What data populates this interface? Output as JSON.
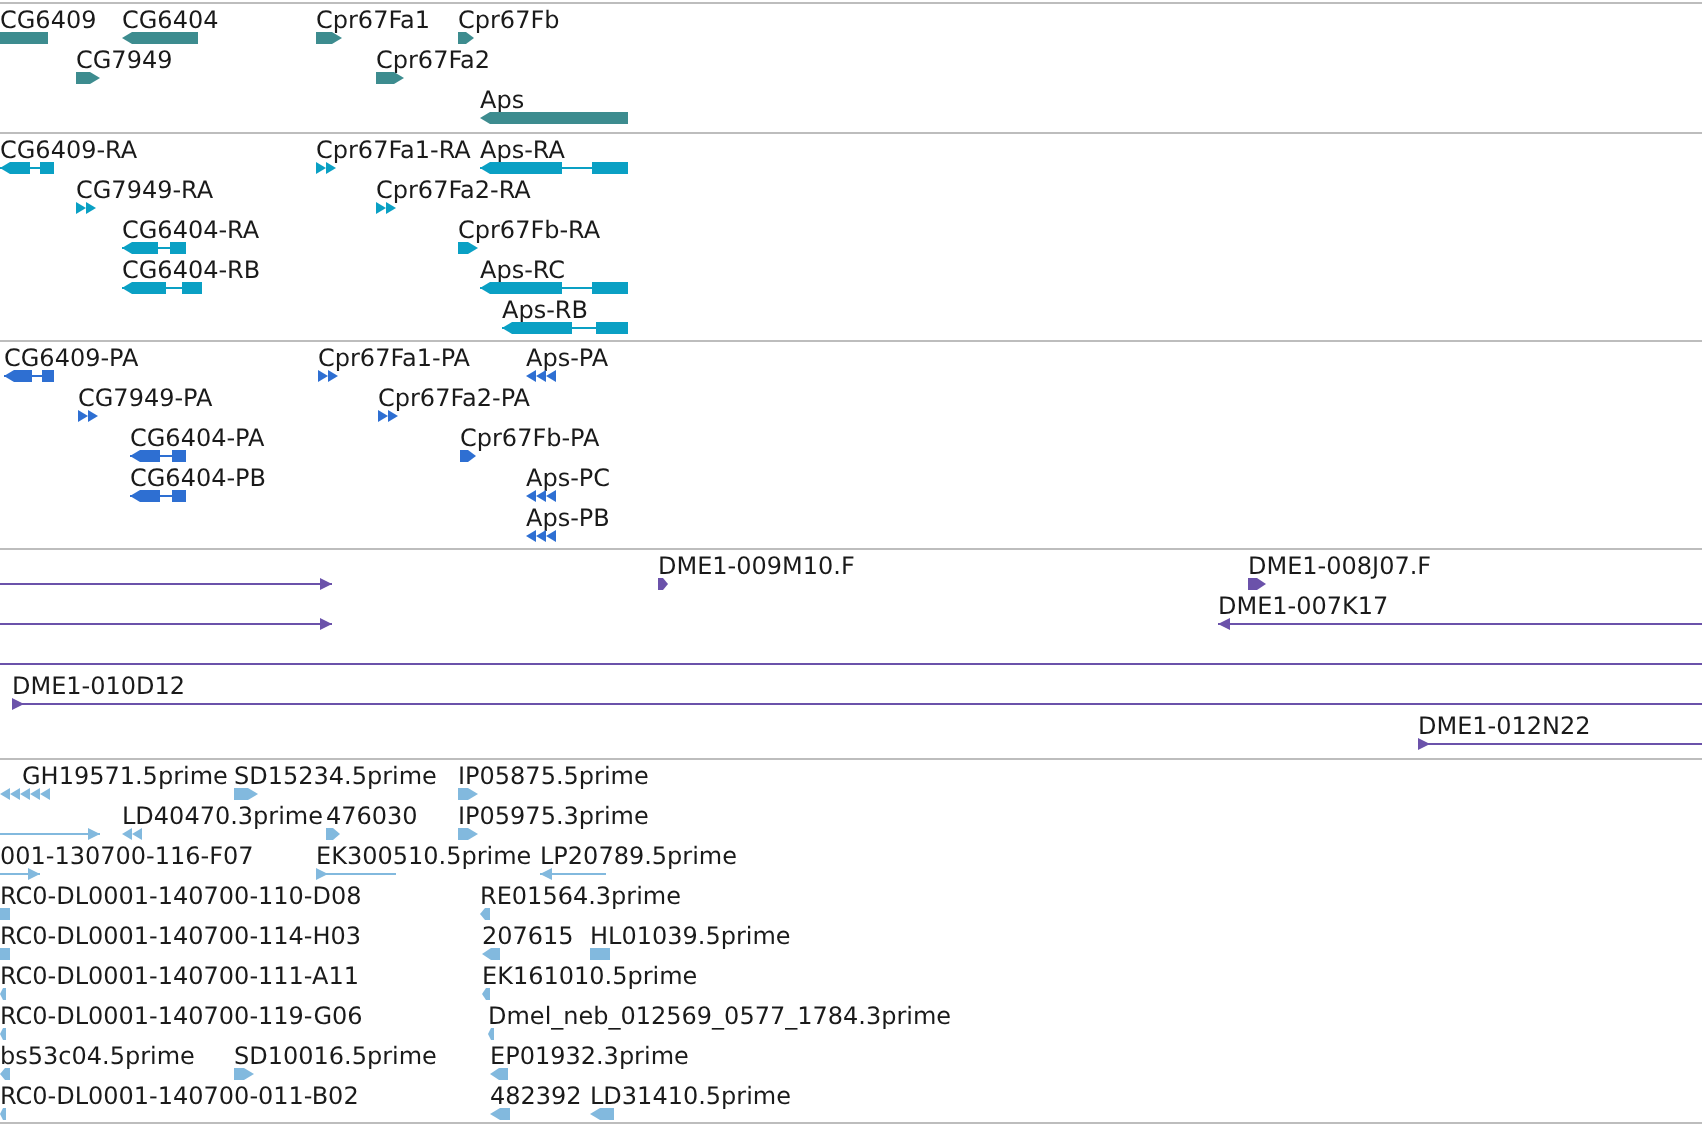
{
  "tracks": [
    {
      "kind": "gene",
      "features": [
        {
          "label": "CG6409",
          "kind": "block"
        },
        {
          "label": "CG6404",
          "kind": "block"
        },
        {
          "label": "Cpr67Fa1",
          "kind": "block"
        },
        {
          "label": "Cpr67Fb",
          "kind": "block"
        },
        {
          "label": "CG7949",
          "kind": "block"
        },
        {
          "label": "Cpr67Fa2",
          "kind": "block"
        },
        {
          "label": "Aps",
          "kind": "block"
        }
      ]
    },
    {
      "kind": "transcript",
      "features": [
        {
          "label": "CG6409-RA",
          "kind": "exons"
        },
        {
          "label": "Cpr67Fa1-RA",
          "kind": "chevrons"
        },
        {
          "label": "Aps-RA",
          "kind": "exons"
        },
        {
          "label": "CG7949-RA",
          "kind": "chevrons"
        },
        {
          "label": "Cpr67Fa2-RA",
          "kind": "chevrons"
        },
        {
          "label": "CG6404-RA",
          "kind": "exons"
        },
        {
          "label": "Cpr67Fb-RA",
          "kind": "block"
        },
        {
          "label": "CG6404-RB",
          "kind": "exons"
        },
        {
          "label": "Aps-RC",
          "kind": "exons"
        },
        {
          "label": "Aps-RB",
          "kind": "exons"
        }
      ]
    },
    {
      "kind": "protein",
      "features": [
        {
          "label": "CG6409-PA",
          "kind": "exons"
        },
        {
          "label": "Cpr67Fa1-PA",
          "kind": "chevrons"
        },
        {
          "label": "Aps-PA",
          "kind": "chevrons"
        },
        {
          "label": "CG7949-PA",
          "kind": "chevrons"
        },
        {
          "label": "Cpr67Fa2-PA",
          "kind": "chevrons"
        },
        {
          "label": "CG6404-PA",
          "kind": "exons"
        },
        {
          "label": "Cpr67Fb-PA",
          "kind": "block"
        },
        {
          "label": "CG6404-PB",
          "kind": "exons"
        },
        {
          "label": "Aps-PC",
          "kind": "chevrons"
        },
        {
          "label": "Aps-PB",
          "kind": "chevrons"
        }
      ]
    },
    {
      "kind": "clone",
      "features": [
        {
          "kind": "line_end"
        },
        {
          "label": "DME1-009M10.F",
          "kind": "block"
        },
        {
          "label": "DME1-008J07.F",
          "kind": "block"
        },
        {
          "kind": "line_end"
        },
        {
          "label": "DME1-007K17",
          "kind": "line"
        },
        {
          "kind": "line"
        },
        {
          "label": "DME1-010D12",
          "kind": "line"
        },
        {
          "label": "DME1-012N22",
          "kind": "line"
        }
      ]
    },
    {
      "kind": "est",
      "features": [
        {
          "label": "GH19571.5prime",
          "kind": "chevrons"
        },
        {
          "label": "SD15234.5prime",
          "kind": "block"
        },
        {
          "label": "IP05875.5prime",
          "kind": "block"
        },
        {
          "kind": "line_end"
        },
        {
          "label": "LD40470.3prime",
          "kind": "chevrons"
        },
        {
          "label": "476030",
          "kind": "block"
        },
        {
          "label": "IP05975.3prime",
          "kind": "block"
        },
        {
          "label": "001-130700-116-F07",
          "kind": "line_end"
        },
        {
          "label": "EK300510.5prime",
          "kind": "line"
        },
        {
          "label": "LP20789.5prime",
          "kind": "line"
        },
        {
          "label": "RC0-DL0001-140700-110-D08",
          "kind": "block"
        },
        {
          "label": "RE01564.3prime",
          "kind": "block"
        },
        {
          "label": "RC0-DL0001-140700-114-H03",
          "kind": "block"
        },
        {
          "label": "207615",
          "kind": "block"
        },
        {
          "label": "HL01039.5prime",
          "kind": "block"
        },
        {
          "label": "RC0-DL0001-140700-111-A11",
          "kind": "block"
        },
        {
          "label": "EK161010.5prime",
          "kind": "block"
        },
        {
          "label": "RC0-DL0001-140700-119-G06",
          "kind": "block"
        },
        {
          "label": "Dmel_neb_012569_0577_1784.3prime",
          "kind": "block"
        },
        {
          "label": "bs53c04.5prime",
          "kind": "block"
        },
        {
          "label": "SD10016.5prime",
          "kind": "block"
        },
        {
          "label": "EP01932.3prime",
          "kind": "block"
        },
        {
          "label": "RC0-DL0001-140700-011-B02",
          "kind": "block"
        },
        {
          "label": "482392",
          "kind": "block"
        },
        {
          "label": "LD31410.5prime",
          "kind": "block"
        }
      ]
    }
  ]
}
